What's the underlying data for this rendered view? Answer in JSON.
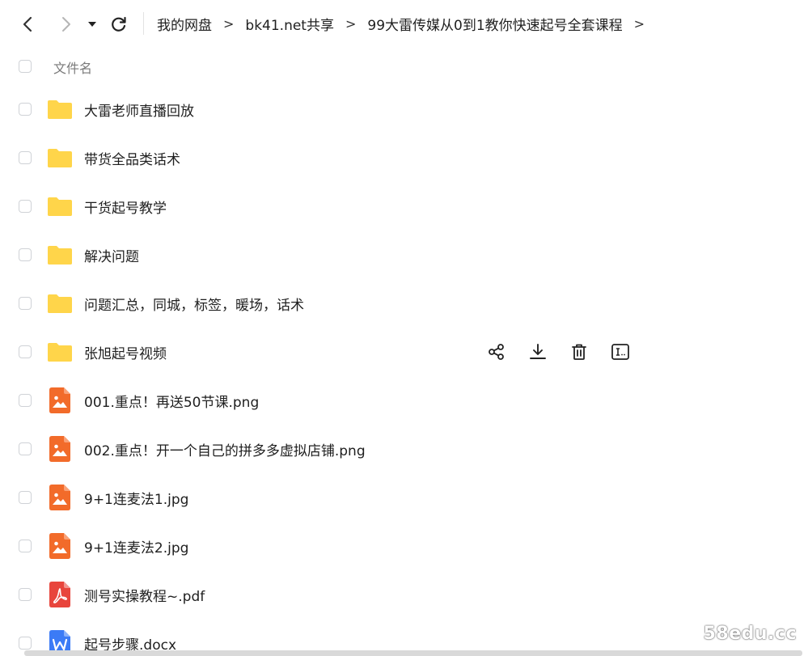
{
  "nav": {
    "back_icon": "chevron-left-icon",
    "forward_icon": "chevron-right-icon",
    "history_icon": "caret-down-icon",
    "refresh_icon": "refresh-icon"
  },
  "breadcrumb": {
    "items": [
      "我的网盘",
      "bk41.net共享",
      "99大雷传媒从0到1教你快速起号全套课程"
    ],
    "separator": ">"
  },
  "list_header": {
    "name_label": "文件名"
  },
  "files": [
    {
      "name": "大雷老师直播回放",
      "type": "folder"
    },
    {
      "name": "带货全品类话术",
      "type": "folder"
    },
    {
      "name": "干货起号教学",
      "type": "folder"
    },
    {
      "name": "解决问题",
      "type": "folder"
    },
    {
      "name": "问题汇总，同城，标签，暖场，话术",
      "type": "folder"
    },
    {
      "name": "张旭起号视频",
      "type": "folder",
      "hovered": true
    },
    {
      "name": "001.重点！再送50节课.png",
      "type": "image"
    },
    {
      "name": "002.重点！开一个自己的拼多多虚拟店铺.png",
      "type": "image"
    },
    {
      "name": "9+1连麦法1.jpg",
      "type": "image"
    },
    {
      "name": "9+1连麦法2.jpg",
      "type": "image"
    },
    {
      "name": "测号实操教程~.pdf",
      "type": "pdf"
    },
    {
      "name": "起号步骤.docx",
      "type": "doc"
    }
  ],
  "row_actions": [
    "share-icon",
    "download-icon",
    "delete-icon",
    "rename-icon"
  ],
  "colors": {
    "folder": "#FFD54A",
    "image": "#F26B2A",
    "pdf": "#E8453C",
    "doc": "#3B7BF6"
  },
  "watermark": "58edu.cc"
}
